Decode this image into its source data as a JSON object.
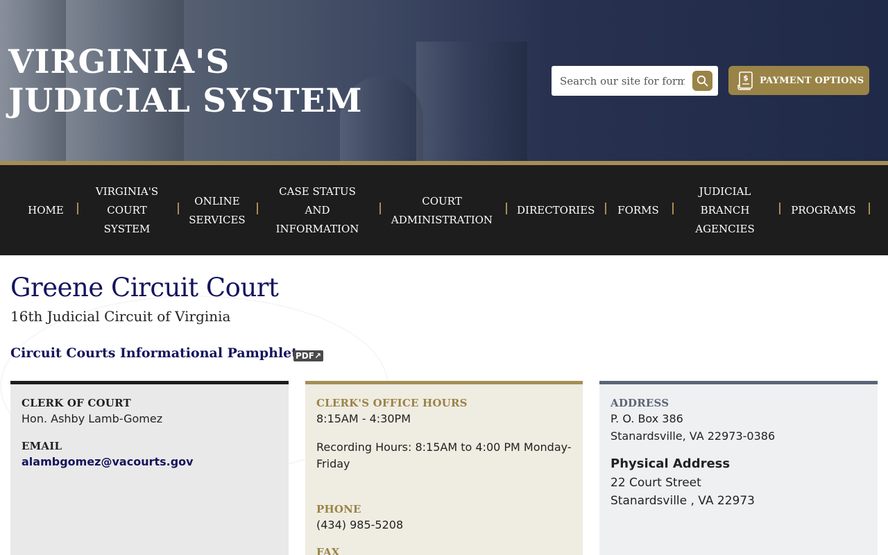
{
  "header": {
    "site_title": "VIRGINIA'S JUDICIAL SYSTEM",
    "search_placeholder": "Search our site for forms,",
    "payment_label": "PAYMENT OPTIONS"
  },
  "nav": {
    "items": [
      "HOME",
      "VIRGINIA'S COURT SYSTEM",
      "ONLINE SERVICES",
      "CASE STATUS AND INFORMATION",
      "COURT ADMINISTRATION",
      "DIRECTORIES",
      "FORMS",
      "JUDICIAL BRANCH AGENCIES",
      "PROGRAMS"
    ]
  },
  "main": {
    "title": "Greene Circuit Court",
    "subtitle": "16th Judicial Circuit of Virginia",
    "pamphlet_link": "Circuit Courts Informational Pamphlet",
    "pdf_badge": "PDF↗"
  },
  "cards": {
    "clerk": {
      "label": "CLERK OF COURT",
      "name": "Hon. Ashby Lamb-Gomez",
      "email_label": "EMAIL",
      "email": "alambgomez@vacourts.gov"
    },
    "hours": {
      "label": "CLERK'S OFFICE HOURS",
      "hours": "8:15AM - 4:30PM",
      "recording": "Recording Hours: 8:15AM to 4:00 PM Monday-Friday",
      "phone_label": "PHONE",
      "phone": "(434) 985-5208",
      "fax_label": "FAX"
    },
    "address": {
      "label": "ADDRESS",
      "line1": "P. O. Box 386",
      "line2": "Stanardsville, VA 22973-0386",
      "physical_label": "Physical Address",
      "physical_line1": "22 Court Street",
      "physical_line2": "Stanardsville , VA 22973"
    }
  },
  "colors": {
    "navy": "#14145e",
    "gold": "#a58e56",
    "nav_bg": "#1d1d1d",
    "header_bg": "#1f2a48"
  }
}
